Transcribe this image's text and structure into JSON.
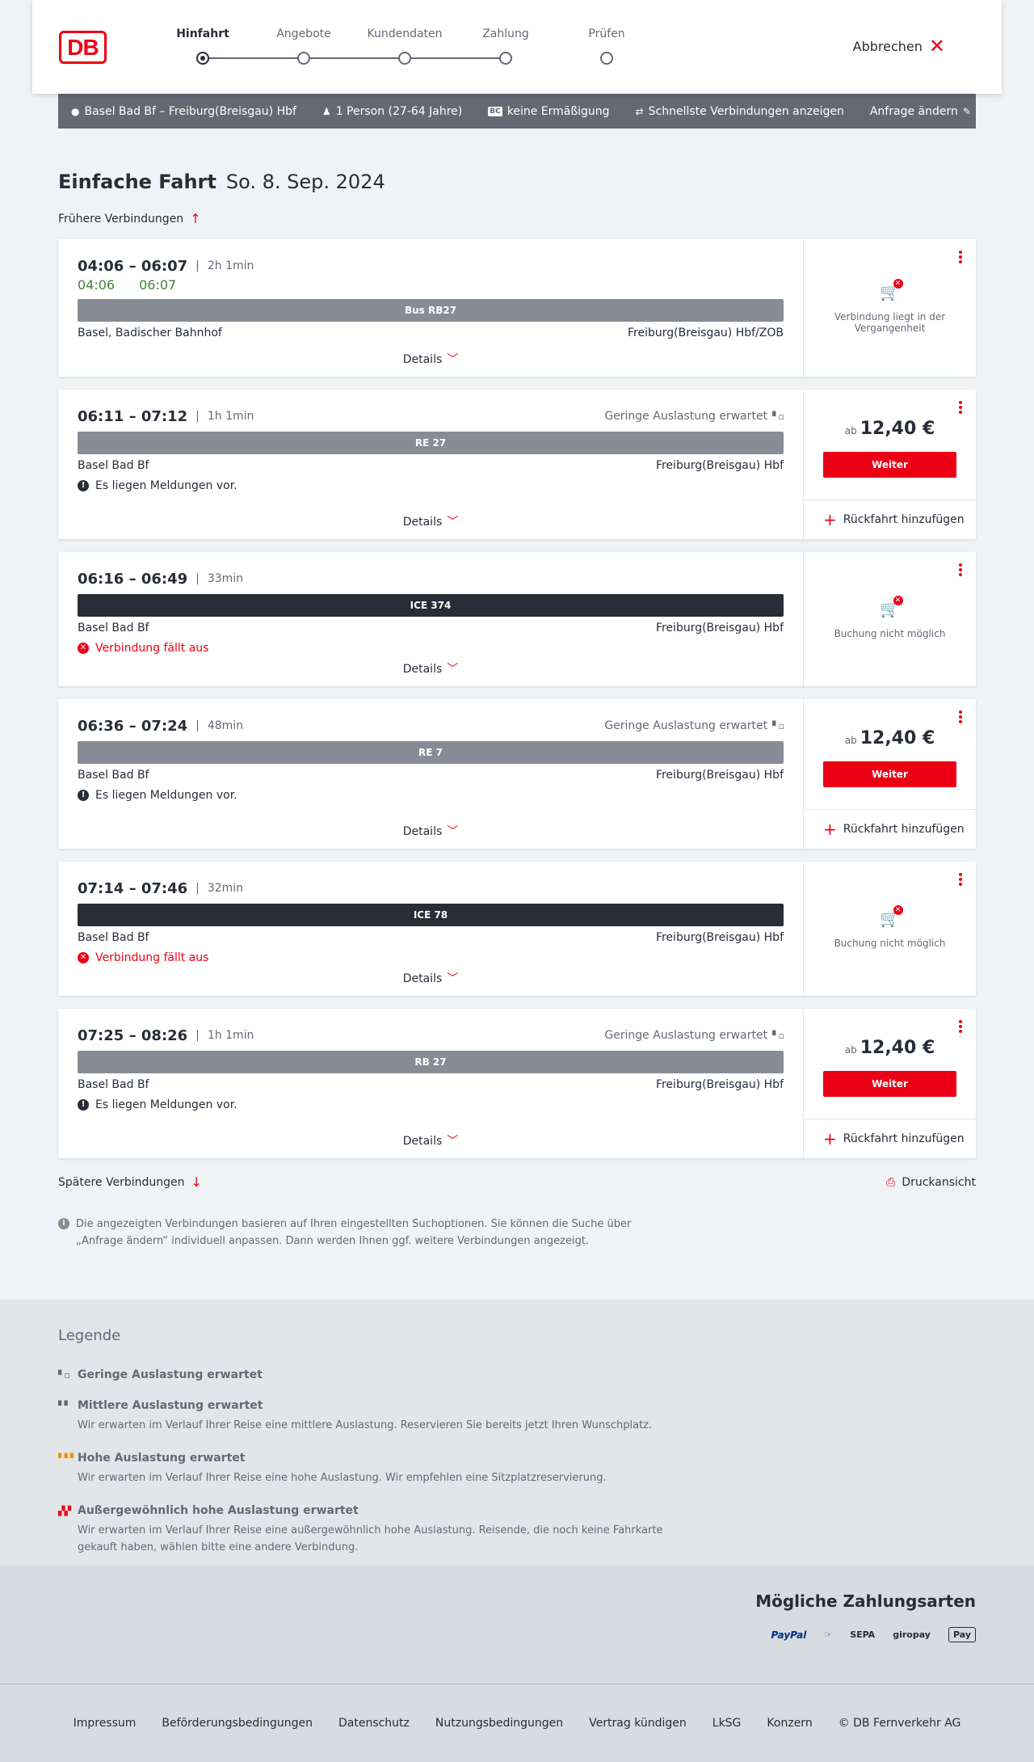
{
  "header": {
    "logo": "DB",
    "steps": [
      {
        "label": "Hinfahrt"
      },
      {
        "label": "Angebote"
      },
      {
        "label": "Kundendaten"
      },
      {
        "label": "Zahlung"
      },
      {
        "label": "Prüfen"
      }
    ],
    "active_step": 0,
    "cancel_label": "Abbrechen"
  },
  "search": {
    "route": "Basel Bad Bf – Freiburg(Breisgau) Hbf",
    "passengers": "1 Person (27-64 Jahre)",
    "bahncard_badge": "BC",
    "discount": "keine Ermäßigung",
    "option": "Schnellste Verbindungen anzeigen",
    "change_label": "Anfrage ändern"
  },
  "page": {
    "title": "Einfache Fahrt",
    "date": "So. 8. Sep. 2024",
    "earlier_label": "Frühere Verbindungen",
    "later_label": "Spätere Verbindungen",
    "print_label": "Druckansicht",
    "info_text": "Die angezeigten Verbindungen basieren auf Ihren eingestellten Suchoptionen. Sie können die Suche über „Anfrage ändern“ individuell anpassen. Dann werden Ihnen ggf. weitere Verbindungen angezeigt.",
    "details_label": "Details",
    "weiter_label": "Weiter",
    "return_label": "Rückfahrt hinzufügen"
  },
  "connections": [
    {
      "times": "04:06 – 06:07",
      "duration": "2h 1min",
      "rt_dep": "04:06",
      "rt_arr": "06:07",
      "train": "Bus RB27",
      "from": "Basel, Badischer Bahnhof",
      "to": "Freiburg(Breisgau) Hbf/ZOB",
      "side_text": "Verbindung liegt in der Vergangenheit"
    },
    {
      "times": "06:11 – 07:12",
      "duration": "1h 1min",
      "occupancy": "Geringe Auslastung erwartet",
      "train": "RE 27",
      "from": "Basel Bad Bf",
      "to": "Freiburg(Breisgau) Hbf",
      "message": "Es liegen Meldungen vor.",
      "price_prefix": "ab",
      "price": "12,40 €"
    },
    {
      "times": "06:16 – 06:49",
      "duration": "33min",
      "train": "ICE 374",
      "from": "Basel Bad Bf",
      "to": "Freiburg(Breisgau) Hbf",
      "message": "Verbindung fällt aus",
      "side_text": "Buchung nicht möglich"
    },
    {
      "times": "06:36 – 07:24",
      "duration": "48min",
      "occupancy": "Geringe Auslastung erwartet",
      "train": "RE 7",
      "from": "Basel Bad Bf",
      "to": "Freiburg(Breisgau) Hbf",
      "message": "Es liegen Meldungen vor.",
      "price_prefix": "ab",
      "price": "12,40 €"
    },
    {
      "times": "07:14 – 07:46",
      "duration": "32min",
      "train": "ICE 78",
      "from": "Basel Bad Bf",
      "to": "Freiburg(Breisgau) Hbf",
      "message": "Verbindung fällt aus",
      "side_text": "Buchung nicht möglich"
    },
    {
      "times": "07:25 – 08:26",
      "duration": "1h 1min",
      "occupancy": "Geringe Auslastung erwartet",
      "train": "RB 27",
      "from": "Basel Bad Bf",
      "to": "Freiburg(Breisgau) Hbf",
      "message": "Es liegen Meldungen vor.",
      "price_prefix": "ab",
      "price": "12,40 €"
    }
  ],
  "legend": {
    "title": "Legende",
    "items": [
      {
        "title": "Geringe Auslastung erwartet",
        "desc": ""
      },
      {
        "title": "Mittlere Auslastung erwartet",
        "desc": "Wir erwarten im Verlauf Ihrer Reise eine mittlere Auslastung. Reservieren Sie bereits jetzt Ihren Wunschplatz."
      },
      {
        "title": "Hohe Auslastung erwartet",
        "desc": "Wir erwarten im Verlauf Ihrer Reise eine hohe Auslastung. Wir empfehlen eine Sitzplatzreservierung."
      },
      {
        "title": "Außergewöhnlich hohe Auslastung erwartet",
        "desc": "Wir erwarten im Verlauf Ihrer Reise eine außergewöhnlich hohe Auslastung. Reisende, die noch keine Fahrkarte gekauft haben, wählen bitte eine andere Verbindung."
      }
    ]
  },
  "payments": {
    "title": "Mögliche Zahlungsarten",
    "logos": [
      "PayPal",
      "SEPA",
      "giropay",
      "Pay"
    ]
  },
  "footer": {
    "links": [
      "Impressum",
      "Beförderungsbedingungen",
      "Datenschutz",
      "Nutzungsbedingungen",
      "Vertrag kündigen",
      "LkSG",
      "Konzern",
      "© DB Fernverkehr AG"
    ]
  },
  "colors": {
    "brand": "#ec0016",
    "realtime": "#408335",
    "bar_regional": "#878c96",
    "bar_longdistance": "#282d37"
  }
}
